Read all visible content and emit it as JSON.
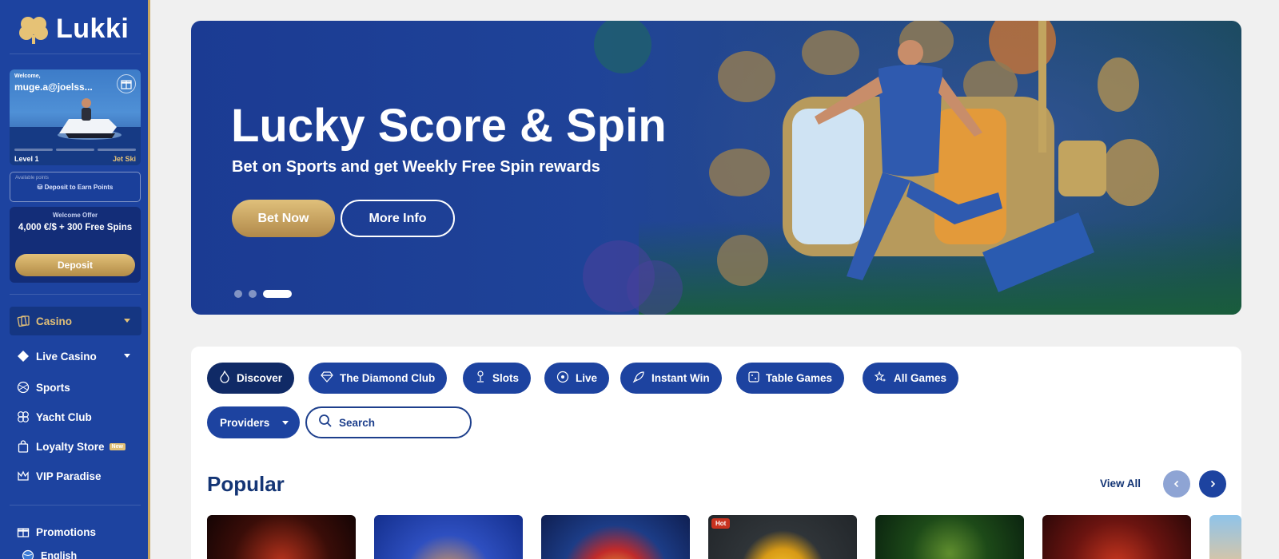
{
  "brand": {
    "name": "Lukki"
  },
  "profile": {
    "welcome": "Welcome,",
    "email": "muge.a@joelss...",
    "level_left": "Level 1",
    "level_right": "Jet Ski"
  },
  "points": {
    "label": "Available points",
    "cta": "Deposit to Earn Points"
  },
  "offer": {
    "title": "Welcome Offer",
    "text": "4,000 €/$ + 300 Free Spins",
    "button": "Deposit"
  },
  "nav": [
    {
      "label": "Casino",
      "icon": "cards-icon"
    },
    {
      "label": "Live Casino",
      "icon": "diamond-icon"
    },
    {
      "label": "Sports",
      "icon": "ball-icon"
    },
    {
      "label": "Yacht Club",
      "icon": "clover-icon"
    },
    {
      "label": "Loyalty Store",
      "icon": "bag-icon",
      "badge": "New"
    },
    {
      "label": "VIP Paradise",
      "icon": "crown-icon"
    },
    {
      "label": "Promotions",
      "icon": "gift-icon"
    },
    {
      "label": "English",
      "icon": "globe-icon"
    }
  ],
  "hero": {
    "title": "Lucky Score & Spin",
    "subtitle": "Bet on Sports and get Weekly Free Spin rewards",
    "primary_button": "Bet Now",
    "secondary_button": "More Info",
    "slide_count": 3,
    "active_slide": 3
  },
  "categories": [
    {
      "label": "Discover",
      "icon": "flame-icon"
    },
    {
      "label": "The Diamond Club",
      "icon": "diamond-icon"
    },
    {
      "label": "Slots",
      "icon": "joystick-icon"
    },
    {
      "label": "Live",
      "icon": "live-icon"
    },
    {
      "label": "Instant Win",
      "icon": "rocket-icon"
    },
    {
      "label": "Table Games",
      "icon": "dice-icon"
    },
    {
      "label": "All Games",
      "icon": "stars-icon"
    }
  ],
  "filters": {
    "providers_label": "Providers",
    "search_placeholder": "Search"
  },
  "popular": {
    "title": "Popular",
    "view_all": "View All",
    "hot_badge": "Hot"
  },
  "colors": {
    "sidebar": "#1d43a0",
    "gold": "#c9a660",
    "primary": "#1d43a0",
    "dark_pill": "#102a66",
    "heading": "#143575"
  }
}
